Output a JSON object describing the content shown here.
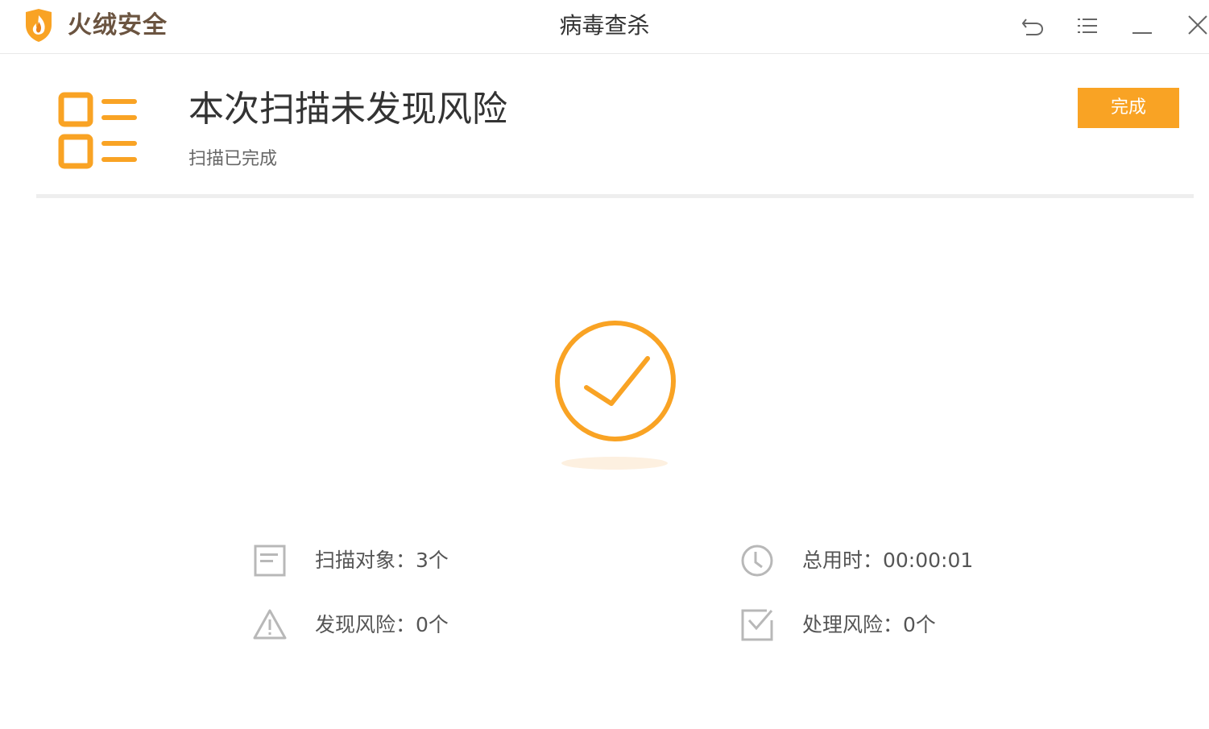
{
  "titlebar": {
    "brand": "火绒安全",
    "title": "病毒查杀",
    "icons": [
      "back-icon",
      "menu-icon",
      "minimize-icon",
      "close-icon"
    ]
  },
  "result": {
    "title": "本次扫描未发现风险",
    "subtitle": "扫描已完成",
    "done_label": "完成"
  },
  "stats": {
    "scanned": "扫描对象：3个",
    "duration": "总用时：00:00:01",
    "risks_found": "发现风险：0个",
    "risks_handled": "处理风险：0个"
  },
  "colors": {
    "accent": "#f9a324",
    "brand_text": "#6b5440",
    "icon_gray": "#b8b8b8"
  }
}
